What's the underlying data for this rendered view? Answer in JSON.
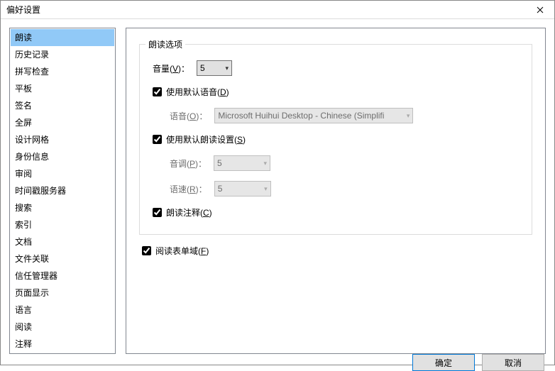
{
  "window": {
    "title": "偏好设置"
  },
  "sidebar": {
    "items": [
      {
        "label": "朗读",
        "selected": true
      },
      {
        "label": "历史记录"
      },
      {
        "label": "拼写检查"
      },
      {
        "label": "平板"
      },
      {
        "label": "签名"
      },
      {
        "label": "全屏"
      },
      {
        "label": "设计网格"
      },
      {
        "label": "身份信息"
      },
      {
        "label": "审阅"
      },
      {
        "label": "时间戳服务器"
      },
      {
        "label": "搜索"
      },
      {
        "label": "索引"
      },
      {
        "label": "文档"
      },
      {
        "label": "文件关联"
      },
      {
        "label": "信任管理器"
      },
      {
        "label": "页面显示"
      },
      {
        "label": "语言"
      },
      {
        "label": "阅读"
      },
      {
        "label": "注释"
      }
    ]
  },
  "content": {
    "group_title": "朗读选项",
    "volume": {
      "label_pre": "音量(",
      "key": "V",
      "label_post": ")",
      "value": "5"
    },
    "use_default_voice": {
      "checked": true,
      "label_pre": "使用默认语音(",
      "key": "D",
      "label_post": ")"
    },
    "voice": {
      "label_pre": "语音(",
      "key": "O",
      "label_post": ")",
      "value": "Microsoft Huihui Desktop - Chinese (Simplifi",
      "disabled": true
    },
    "use_default_settings": {
      "checked": true,
      "label_pre": "使用默认朗读设置(",
      "key": "S",
      "label_post": ")"
    },
    "pitch": {
      "label_pre": "音调(",
      "key": "P",
      "label_post": ")",
      "value": "5",
      "disabled": true
    },
    "rate": {
      "label_pre": "语速(",
      "key": "R",
      "label_post": ")",
      "value": "5",
      "disabled": true
    },
    "read_comments": {
      "checked": true,
      "label_pre": "朗读注释(",
      "key": "C",
      "label_post": ")"
    },
    "read_form_fields": {
      "checked": true,
      "label_pre": "阅读表单域(",
      "key": "F",
      "label_post": ")"
    }
  },
  "footer": {
    "ok": "确定",
    "cancel": "取消"
  }
}
